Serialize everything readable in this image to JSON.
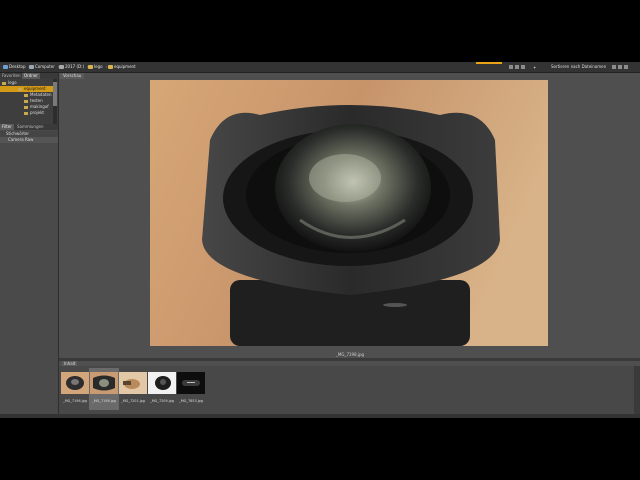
{
  "breadcrumb": [
    {
      "label": "Desktop",
      "color": "#6f9fd8"
    },
    {
      "label": "Computer",
      "color": "#9aa7b4"
    },
    {
      "label": "2017 (D:)",
      "color": "#aaaaaa"
    },
    {
      "label": "lego",
      "color": "#d9b34d"
    },
    {
      "label": "equipment",
      "color": "#d9b34d"
    }
  ],
  "accent_color": "#e8a317",
  "sort_label": "Sortieren nach Dateinamen",
  "panel_tabs": {
    "left": "Favoriten",
    "right": "Ordner"
  },
  "tree": [
    "lego",
    "equipment",
    "Metadaten",
    "testen",
    "makingof",
    "projekt"
  ],
  "tree_selected_index": 1,
  "section_tabs": {
    "a": "Filter",
    "b": "Sammlungen"
  },
  "keywords_header": "Stichwörter",
  "keywords_row": "Camera Raw",
  "content_tab": "Vorschau",
  "preview_caption": "_MG_7198.jpg",
  "filmstrip_tab": "Inhalt",
  "thumbnails": [
    {
      "label": "_MG_7196.jpg",
      "selected": false
    },
    {
      "label": "_MG_7198.jpg",
      "selected": true
    },
    {
      "label": "_MG_7201.jpg",
      "selected": false
    },
    {
      "label": "_MG_7209.jpg",
      "selected": false
    },
    {
      "label": "_MG_7853.jpg",
      "selected": false
    }
  ]
}
